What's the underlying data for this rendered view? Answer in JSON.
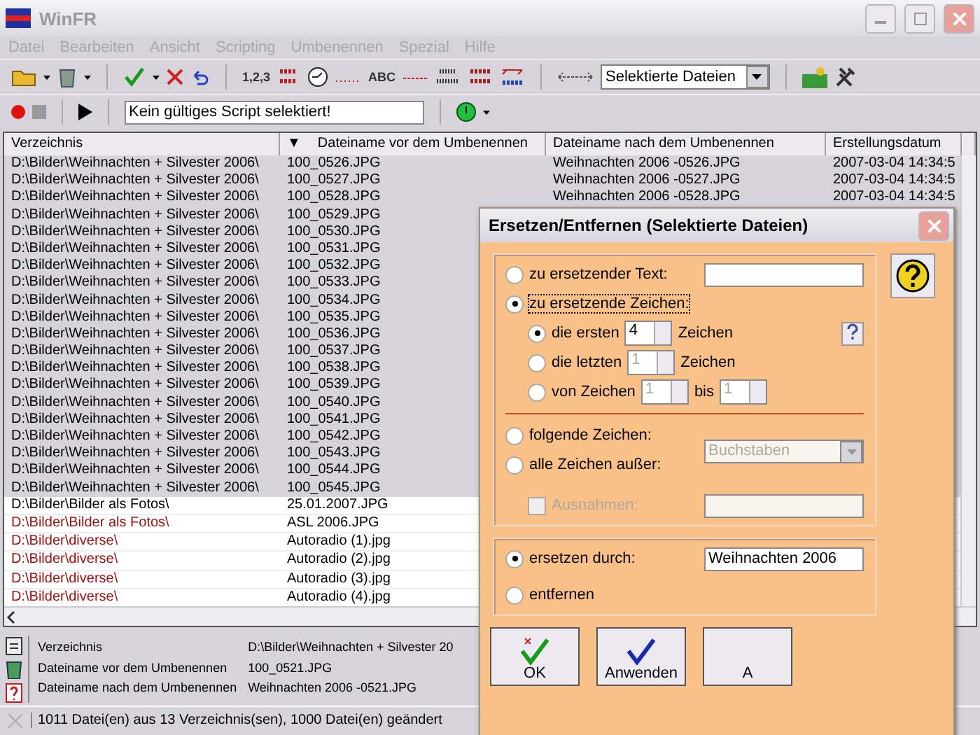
{
  "window": {
    "title": "WinFR"
  },
  "menu": [
    "Datei",
    "Bearbeiten",
    "Ansicht",
    "Scripting",
    "Umbenennen",
    "Spezial",
    "Hilfe"
  ],
  "toolbar": {
    "numbers_label": "1,2,3",
    "abc_label": "ABC",
    "scope": "Selektierte Dateien"
  },
  "script_bar": {
    "script": "Kein gültiges Script selektiert!"
  },
  "table": {
    "columns": [
      "Verzeichnis",
      "▼",
      "Dateiname vor dem Umbenennen",
      "Dateiname nach dem Umbenennen",
      "Erstellungsdatum"
    ],
    "rows": [
      {
        "dir": "D:\\Bilder\\Weihnachten + Silvester 2006\\",
        "before": "100_0526.JPG",
        "after": "Weihnachten 2006 -0526.JPG",
        "date": "2007-03-04 14:34:5",
        "selected": true,
        "color": "#000000"
      },
      {
        "dir": "D:\\Bilder\\Weihnachten + Silvester 2006\\",
        "before": "100_0527.JPG",
        "after": "Weihnachten 2006 -0527.JPG",
        "date": "2007-03-04 14:34:5",
        "selected": true,
        "color": "#000000"
      },
      {
        "dir": "D:\\Bilder\\Weihnachten + Silvester 2006\\",
        "before": "100_0528.JPG",
        "after": "Weihnachten 2006 -0528.JPG",
        "date": "2007-03-04 14:34:5",
        "selected": true,
        "color": "#000000"
      },
      {
        "dir": "D:\\Bilder\\Weihnachten + Silvester 2006\\",
        "before": "100_0529.JPG",
        "selected": true,
        "color": "#000000"
      },
      {
        "dir": "D:\\Bilder\\Weihnachten + Silvester 2006\\",
        "before": "100_0530.JPG",
        "selected": true,
        "color": "#000000"
      },
      {
        "dir": "D:\\Bilder\\Weihnachten + Silvester 2006\\",
        "before": "100_0531.JPG",
        "selected": true,
        "color": "#000000"
      },
      {
        "dir": "D:\\Bilder\\Weihnachten + Silvester 2006\\",
        "before": "100_0532.JPG",
        "selected": true,
        "color": "#000000"
      },
      {
        "dir": "D:\\Bilder\\Weihnachten + Silvester 2006\\",
        "before": "100_0533.JPG",
        "selected": true,
        "color": "#000000"
      },
      {
        "dir": "D:\\Bilder\\Weihnachten + Silvester 2006\\",
        "before": "100_0534.JPG",
        "selected": true,
        "color": "#000000"
      },
      {
        "dir": "D:\\Bilder\\Weihnachten + Silvester 2006\\",
        "before": "100_0535.JPG",
        "selected": true,
        "color": "#000000"
      },
      {
        "dir": "D:\\Bilder\\Weihnachten + Silvester 2006\\",
        "before": "100_0536.JPG",
        "selected": true,
        "color": "#000000"
      },
      {
        "dir": "D:\\Bilder\\Weihnachten + Silvester 2006\\",
        "before": "100_0537.JPG",
        "selected": true,
        "color": "#000000"
      },
      {
        "dir": "D:\\Bilder\\Weihnachten + Silvester 2006\\",
        "before": "100_0538.JPG",
        "selected": true,
        "color": "#000000"
      },
      {
        "dir": "D:\\Bilder\\Weihnachten + Silvester 2006\\",
        "before": "100_0539.JPG",
        "selected": true,
        "color": "#000000"
      },
      {
        "dir": "D:\\Bilder\\Weihnachten + Silvester 2006\\",
        "before": "100_0540.JPG",
        "selected": true,
        "color": "#000000"
      },
      {
        "dir": "D:\\Bilder\\Weihnachten + Silvester 2006\\",
        "before": "100_0541.JPG",
        "selected": true,
        "color": "#000000"
      },
      {
        "dir": "D:\\Bilder\\Weihnachten + Silvester 2006\\",
        "before": "100_0542.JPG",
        "selected": true,
        "color": "#000000"
      },
      {
        "dir": "D:\\Bilder\\Weihnachten + Silvester 2006\\",
        "before": "100_0543.JPG",
        "selected": true,
        "color": "#000000"
      },
      {
        "dir": "D:\\Bilder\\Weihnachten + Silvester 2006\\",
        "before": "100_0544.JPG",
        "selected": true,
        "color": "#000000"
      },
      {
        "dir": "D:\\Bilder\\Weihnachten + Silvester 2006\\",
        "before": "100_0545.JPG",
        "selected": true,
        "color": "#000000"
      },
      {
        "dir": "D:\\Bilder\\Bilder als Fotos\\",
        "before": "25.01.2007.JPG",
        "selected": false,
        "color": "#000000"
      },
      {
        "dir": "D:\\Bilder\\Bilder als Fotos\\",
        "before": "ASL 2006.JPG",
        "selected": false,
        "color": "#a01010"
      },
      {
        "dir": "D:\\Bilder\\diverse\\",
        "before": "Autoradio (1).jpg",
        "selected": false,
        "color": "#a01010"
      },
      {
        "dir": "D:\\Bilder\\diverse\\",
        "before": "Autoradio (2).jpg",
        "selected": false,
        "color": "#a01010"
      },
      {
        "dir": "D:\\Bilder\\diverse\\",
        "before": "Autoradio (3).jpg",
        "selected": false,
        "color": "#a01010"
      },
      {
        "dir": "D:\\Bilder\\diverse\\",
        "before": "Autoradio (4).jpg",
        "selected": false,
        "color": "#a01010"
      }
    ]
  },
  "details": [
    {
      "label": "Verzeichnis",
      "value": "D:\\Bilder\\Weihnachten + Silvester 20"
    },
    {
      "label": "Dateiname vor dem Umbenennen",
      "value": "100_0521.JPG"
    },
    {
      "label": "Dateiname nach dem Umbenennen",
      "value": "Weihnachten 2006 -0521.JPG"
    }
  ],
  "status_bar": "1011 Datei(en) aus 13 Verzeichnis(sen), 1000 Datei(en) geändert",
  "dialog": {
    "title": "Ersetzen/Entfernen (Selektierte Dateien)",
    "text_option": {
      "label": "zu ersetzender Text:",
      "selected": false
    },
    "chars_option": {
      "label": "zu ersetzende Zeichen:",
      "selected": true
    },
    "first": {
      "label": "die ersten",
      "value": "4",
      "unit": "Zeichen",
      "selected": true,
      "disabled": false
    },
    "last": {
      "label": "die letzten",
      "value": "1",
      "unit": "Zeichen",
      "selected": false,
      "disabled": true
    },
    "range": {
      "label": "von Zeichen",
      "from": "1",
      "to_label": "bis",
      "to": "1",
      "selected": false,
      "disabled": true
    },
    "following": {
      "label": "folgende Zeichen:",
      "selected": false
    },
    "all_except": {
      "label": "alle Zeichen außer:",
      "selected": false
    },
    "char_type": {
      "value": "Buchstaben",
      "disabled": true
    },
    "exceptions": {
      "label": "Ausnahmen:",
      "checked": false,
      "disabled": true
    },
    "replace": {
      "label": "ersetzen durch:",
      "value": "Weihnachten 2006",
      "selected": true
    },
    "remove": {
      "label": "entfernen",
      "selected": false
    },
    "buttons": [
      {
        "kind": "ok",
        "label": "OK"
      },
      {
        "kind": "apply",
        "label": "Anwenden"
      },
      {
        "kind": "other",
        "label": "A"
      }
    ]
  }
}
